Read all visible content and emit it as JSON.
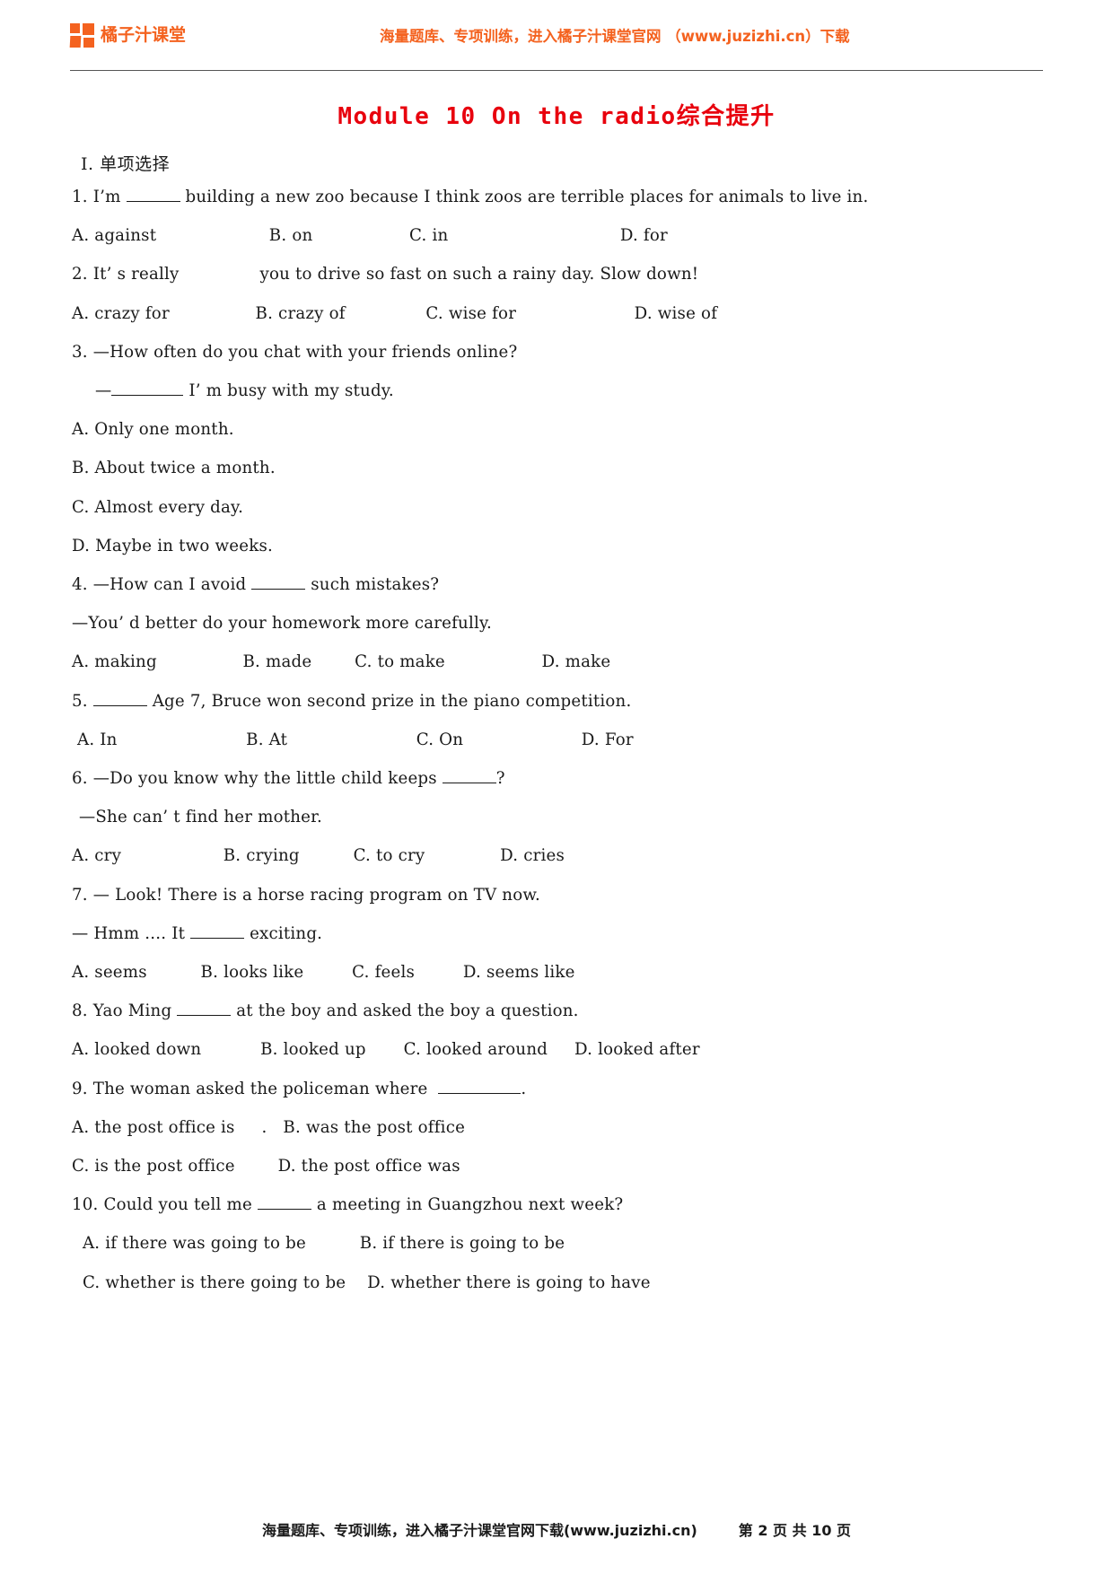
{
  "header": {
    "logo_text": "橘子汁课堂",
    "slogan": "海量题库、专项训练，进入橘子汁课堂官网 （www.juzizhi.cn）下载",
    "brand_color": "#f4621f"
  },
  "title": "Module 10 On the radio综合提升",
  "title_color": "#e8000d",
  "section": {
    "heading": "Ⅰ. 单项选择"
  },
  "questions": [
    {
      "stem_a": "1. I’m ",
      "stem_b": " building a new zoo because I think zoos are terrible places for animals to live in.",
      "options": "A. against                     B. on                  C. in                                D. for"
    },
    {
      "stem_a": "2. It’ s really ",
      "stem_b": " you to drive so fast on such a rainy day. Slow down!",
      "options": "A. crazy for                B. crazy of               C. wise for                      D. wise of"
    },
    {
      "stem_q": "3. —How often do you chat with your friends online?",
      "stem_reply_a": "—",
      "stem_reply_b": " I’ m busy with my study.",
      "opt_a": "A. Only one month.",
      "opt_b": "B. About twice a month.",
      "opt_c": "C. Almost every day.",
      "opt_d": "D. Maybe in two weeks."
    },
    {
      "stem_a": "4. —How can I avoid ",
      "stem_b": " such mistakes?",
      "stem2": "—You’ d better do your homework more carefully.",
      "options": "A. making                B. made        C. to make                  D. make"
    },
    {
      "stem_a": "5. ",
      "stem_b": " Age 7, Bruce won second prize in the piano competition.",
      "options": " A. In                        B. At                        C. On                      D. For"
    },
    {
      "stem_a": "6. —Do you know why the little child keeps ",
      "stem_b": "?",
      "stem2": "—She can’ t find her mother.",
      "options": "A. cry                   B. crying          C. to cry              D. cries"
    },
    {
      "stem_q": "7. — Look! There is a horse racing program on TV now.",
      "stem_a": "— Hmm .... It ",
      "stem_b": " exciting.",
      "options": "A. seems          B. looks like         C. feels         D. seems like"
    },
    {
      "stem_a": "8. Yao Ming ",
      "stem_b": " at the boy and asked the boy a question.",
      "options": "A. looked down           B. looked up       C. looked around     D. looked after"
    },
    {
      "stem_a": "9. The woman asked the policeman where  ",
      "stem_b": ".",
      "opt_ab": "A. the post office is     .   B. was the post office",
      "opt_cd": "C. is the post office        D. the post office was"
    },
    {
      "stem_a": "10. Could you tell me ",
      "stem_b": " a meeting in Guangzhou next week?",
      "opt_ab": "  A. if there was going to be          B. if there is going to be",
      "opt_cd": "  C. whether is there going to be    D. whether there is going to have"
    }
  ],
  "footer": {
    "note": "海量题库、专项训练，进入橘子汁课堂官网下载(www.juzizhi.cn)",
    "page": "第 2 页 共 10 页"
  }
}
